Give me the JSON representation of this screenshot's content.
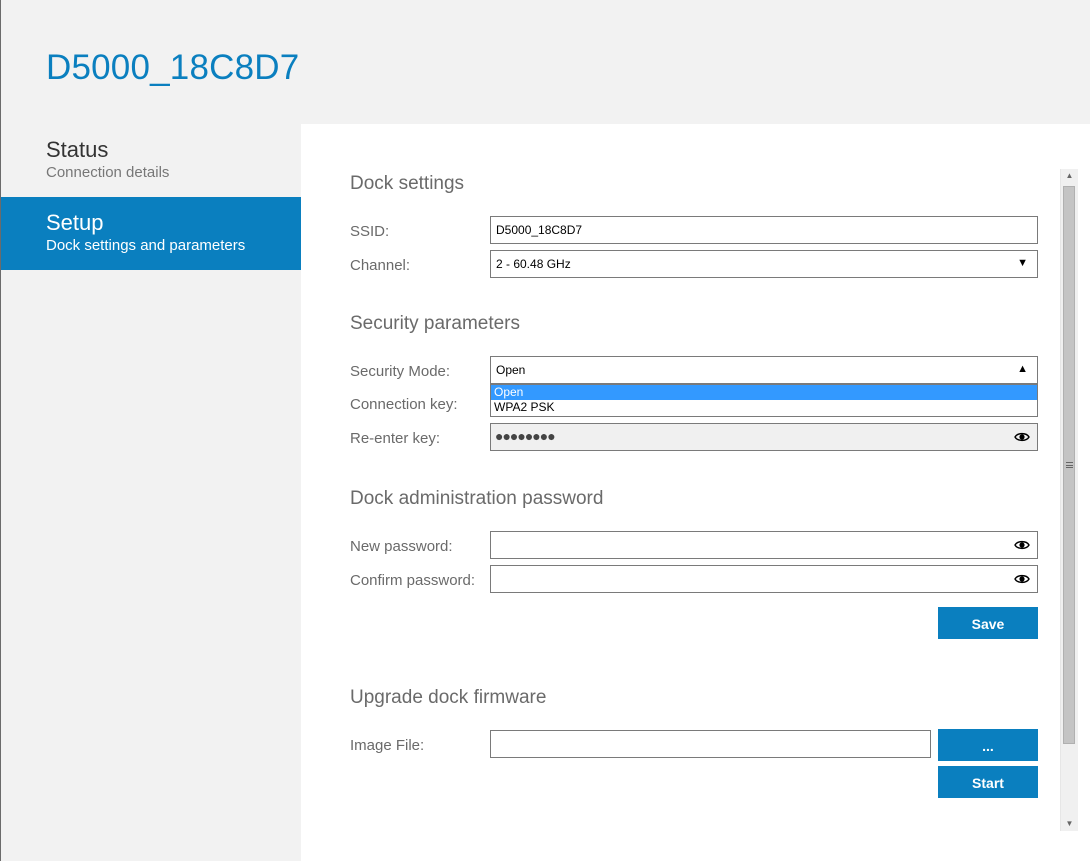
{
  "app": {
    "title": "D5000_18C8D7"
  },
  "nav": {
    "items": [
      {
        "title": "Status",
        "subtitle": "Connection details",
        "active": false
      },
      {
        "title": "Setup",
        "subtitle": "Dock settings and parameters",
        "active": true
      }
    ]
  },
  "dock_settings": {
    "heading": "Dock settings",
    "ssid_label": "SSID:",
    "ssid_value": "D5000_18C8D7",
    "channel_label": "Channel:",
    "channel_value": "2 - 60.48 GHz"
  },
  "security": {
    "heading": "Security parameters",
    "mode_label": "Security Mode:",
    "mode_value": "Open",
    "mode_options": [
      "Open",
      "WPA2 PSK"
    ],
    "mode_selected_option": "Open",
    "connection_key_label": "Connection key:",
    "reenter_key_label": "Re-enter key:",
    "reenter_key_mask": "●●●●●●●●"
  },
  "admin_password": {
    "heading": "Dock administration password",
    "new_label": "New password:",
    "new_value": "",
    "confirm_label": "Confirm password:",
    "confirm_value": "",
    "save_label": "Save"
  },
  "firmware": {
    "heading": "Upgrade dock firmware",
    "image_file_label": "Image File:",
    "image_file_value": "",
    "browse_label": "...",
    "start_label": "Start"
  },
  "icons": {
    "dropdown_closed": "chevron-down-icon",
    "dropdown_open": "chevron-up-icon",
    "reveal": "eye-icon"
  },
  "colors": {
    "accent": "#0a7fbf",
    "selection": "#3399ff",
    "header_background": "#f2f2f2",
    "content_background": "#ffffff"
  }
}
